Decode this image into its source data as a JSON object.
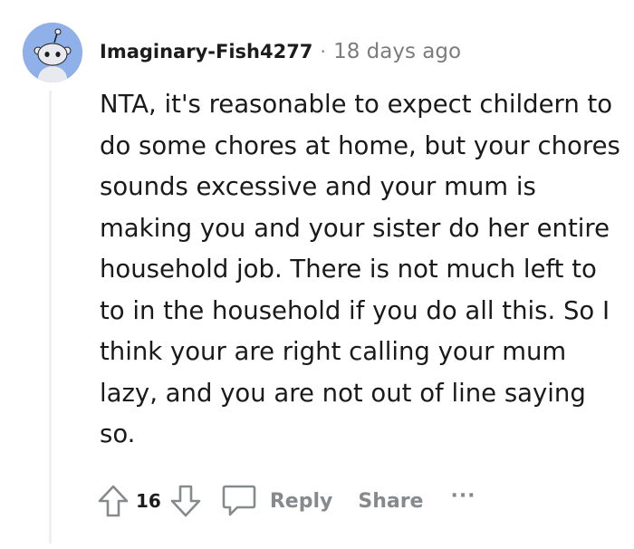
{
  "comment": {
    "author": "Imaginary-Fish4277",
    "separator": "·",
    "time_ago": "18 days ago",
    "body": "NTA, it's reasonable to expect childern to do some chores at home, but your chores sounds excessive and your mum is making you and your sister do her entire household job. There is not much left to to in the household if you do all this. So I think your are right calling your mum lazy, and you are not out of line saying so.",
    "avatar_icon": "snoo-avatar-icon"
  },
  "actions": {
    "upvote_icon": "upvote-arrow-icon",
    "vote_count": "16",
    "downvote_icon": "downvote-arrow-icon",
    "reply_icon": "speech-bubble-icon",
    "reply_label": "Reply",
    "share_label": "Share",
    "more_label": "···"
  },
  "colors": {
    "text": "#1a1a1b",
    "muted": "#878a8c",
    "thread_line": "#edeff1",
    "avatar_bg": "#8fb0e8"
  }
}
